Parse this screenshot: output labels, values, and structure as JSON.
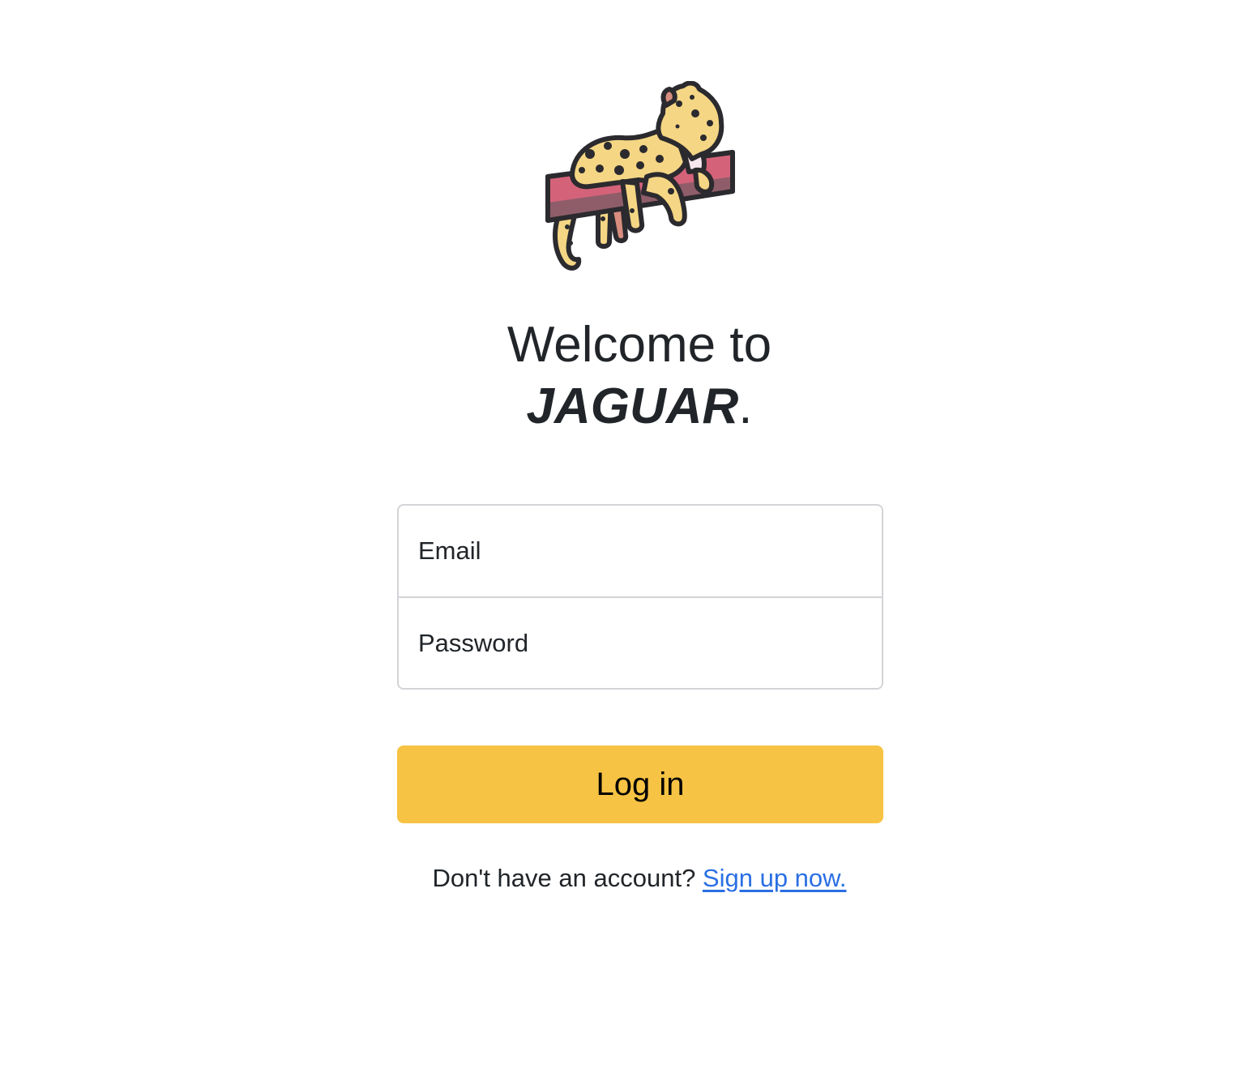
{
  "logo": {
    "name": "jaguar-logo-icon"
  },
  "heading": {
    "line1": "Welcome to",
    "brand": "JAGUAR",
    "period": "."
  },
  "form": {
    "email_placeholder": "Email",
    "password_placeholder": "Password"
  },
  "login_button": {
    "label": "Log in"
  },
  "signup": {
    "prompt": "Don't have an account? ",
    "link_text": "Sign up now."
  },
  "colors": {
    "accent": "#f6c344",
    "link": "#2a6fe3",
    "text": "#212529",
    "border": "#d2d4d7"
  }
}
